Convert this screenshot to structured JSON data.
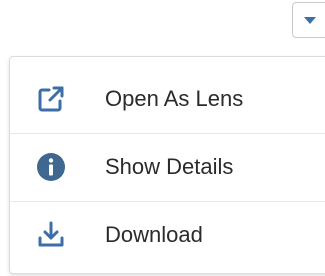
{
  "menu": {
    "trigger_icon": "chevron-down-icon",
    "accent_color": "#3c6ea8",
    "items": [
      {
        "label": "Open As Lens",
        "icon": "external-link-icon"
      },
      {
        "label": "Show Details",
        "icon": "info-icon"
      },
      {
        "label": "Download",
        "icon": "download-icon"
      }
    ]
  }
}
